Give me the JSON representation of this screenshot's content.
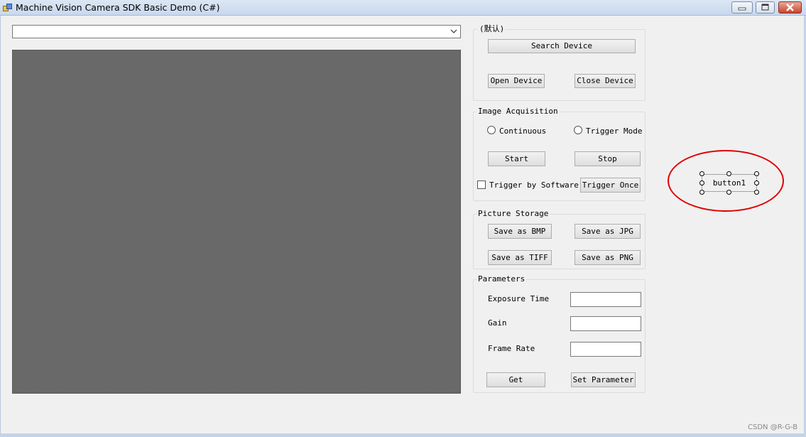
{
  "window": {
    "title": "Machine Vision Camera SDK Basic Demo (C#)",
    "app_icon": "app-window-icon",
    "controls": [
      "minimize-icon",
      "maximize-icon",
      "close-icon"
    ]
  },
  "device_combo": {
    "value": "",
    "icon": "chevron-down-icon"
  },
  "device_group": {
    "label": "(默认)",
    "search_label": "Search Device",
    "open_label": "Open Device",
    "close_label": "Close Device"
  },
  "acquisition": {
    "label": "Image Acquisition",
    "continuous_label": "Continuous",
    "trigger_mode_label": "Trigger Mode",
    "start_label": "Start",
    "stop_label": "Stop",
    "trigger_software_label": "Trigger by Software",
    "trigger_once_label": "Trigger Once"
  },
  "storage": {
    "label": "Picture Storage",
    "bmp_label": "Save as BMP",
    "jpg_label": "Save as JPG",
    "tiff_label": "Save as TIFF",
    "png_label": "Save as PNG"
  },
  "parameters": {
    "label": "Parameters",
    "exposure_label": "Exposure Time",
    "exposure_value": "",
    "gain_label": "Gain",
    "gain_value": "",
    "frame_rate_label": "Frame Rate",
    "frame_rate_value": "",
    "get_label": "Get",
    "set_label": "Set Parameter"
  },
  "designer": {
    "button1_label": "button1",
    "highlight_color": "#e00000"
  },
  "watermark": "CSDN @R-G-B"
}
